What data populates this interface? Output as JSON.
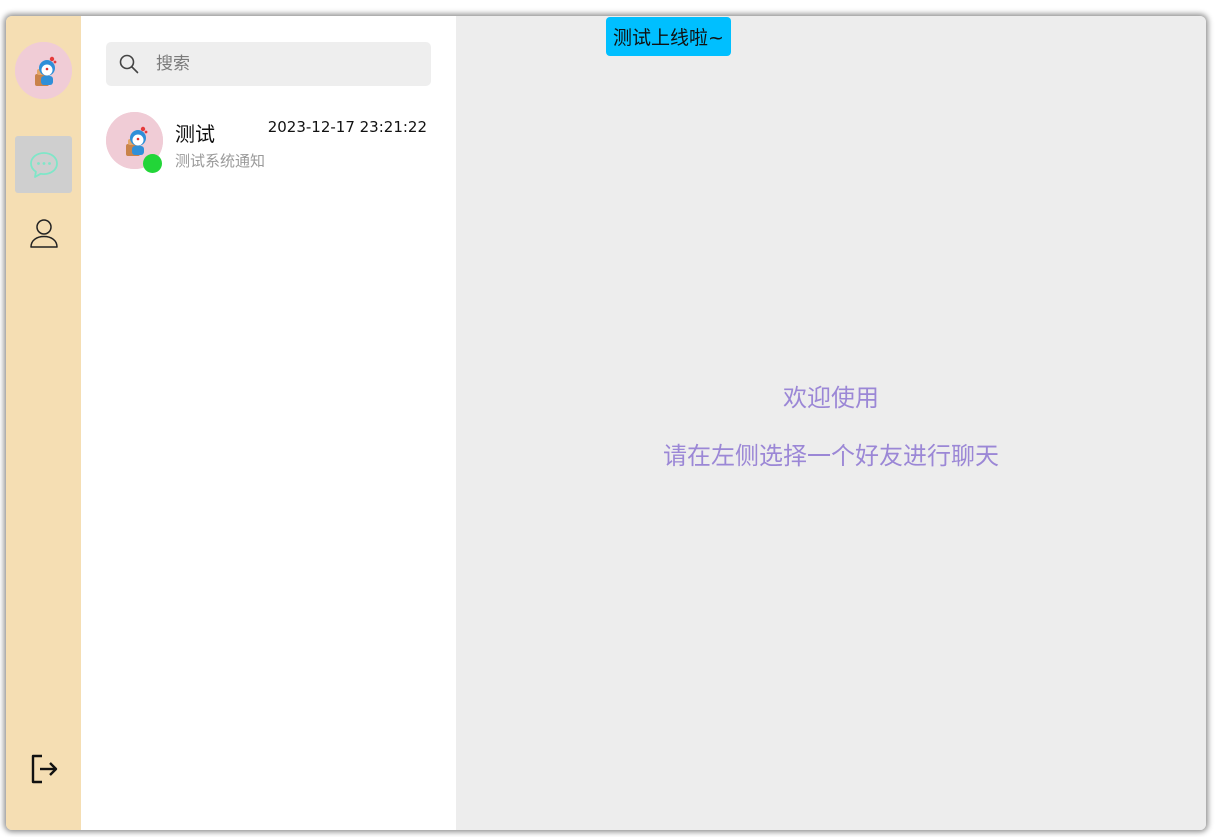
{
  "sidebar": {
    "user_avatar": "doraemon-avatar",
    "nav": [
      {
        "name": "chat",
        "icon": "chat-bubble-icon",
        "active": true
      },
      {
        "name": "contacts",
        "icon": "user-icon",
        "active": false
      }
    ],
    "logout_icon": "logout-icon",
    "background": "#f5deb3"
  },
  "search": {
    "placeholder": "搜索",
    "value": "",
    "icon": "search-icon"
  },
  "sessions": [
    {
      "name": "测试",
      "time": "2023-12-17 23:21:22",
      "preview": "测试系统通知",
      "online": true
    }
  ],
  "main": {
    "welcome_title": "欢迎使用",
    "welcome_sub": "请在左侧选择一个好友进行聊天",
    "text_color": "#9b87d6"
  },
  "toast": {
    "message": "测试上线啦~",
    "color": "#00bfff"
  },
  "colors": {
    "online": "#22d538",
    "active_nav": "#cfcfcf"
  }
}
